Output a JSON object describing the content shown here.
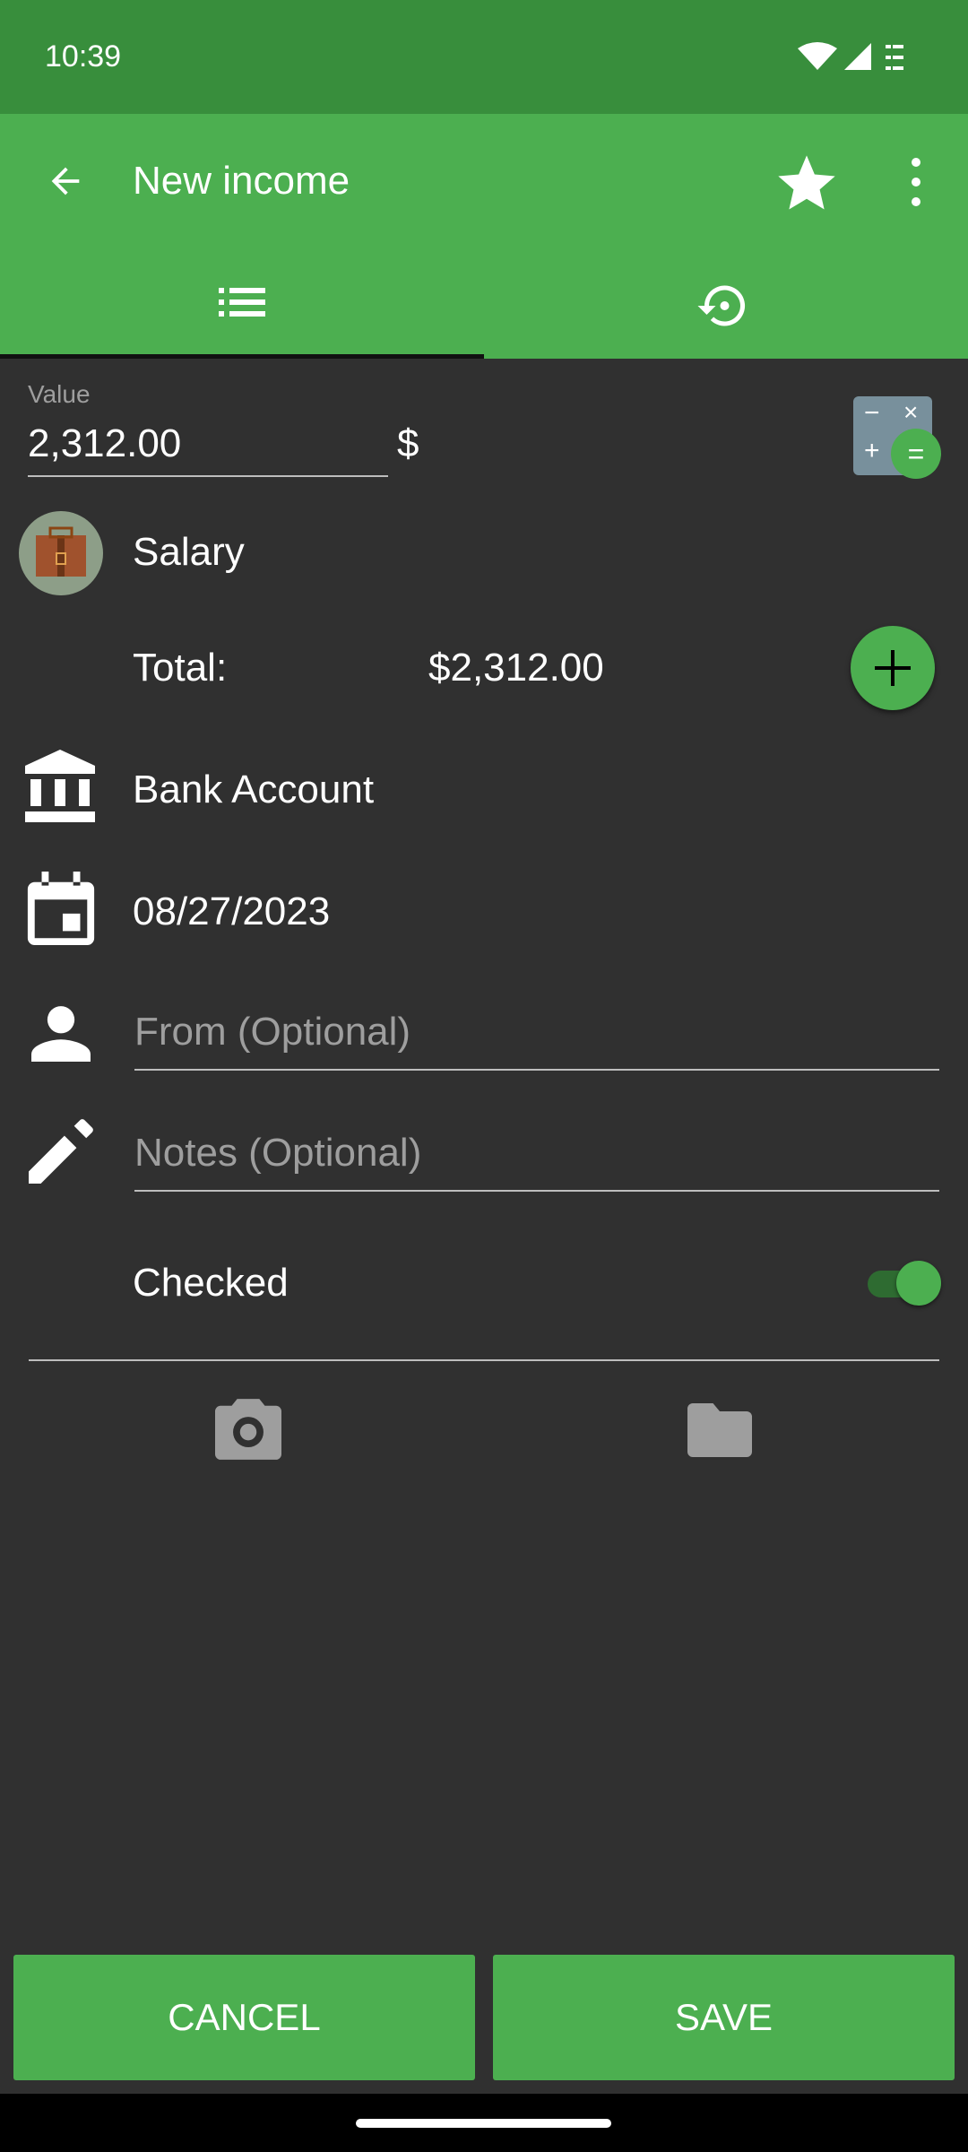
{
  "status_bar": {
    "time": "10:39"
  },
  "app_bar": {
    "title": "New income",
    "tabs": [
      {
        "icon": "list-icon",
        "selected": true
      },
      {
        "icon": "history-icon",
        "selected": false
      }
    ]
  },
  "form": {
    "value_label": "Value",
    "value": "2,312.00",
    "currency": "$",
    "category": "Salary",
    "total_label": "Total:",
    "total_value": "$2,312.00",
    "account": "Bank Account",
    "date": "08/27/2023",
    "from_placeholder": "From (Optional)",
    "notes_placeholder": "Notes (Optional)",
    "checked_label": "Checked",
    "checked": true
  },
  "buttons": {
    "cancel": "CANCEL",
    "save": "SAVE"
  },
  "colors": {
    "primary": "#4caf50",
    "primary_dark": "#388e3c",
    "background": "#303030"
  }
}
